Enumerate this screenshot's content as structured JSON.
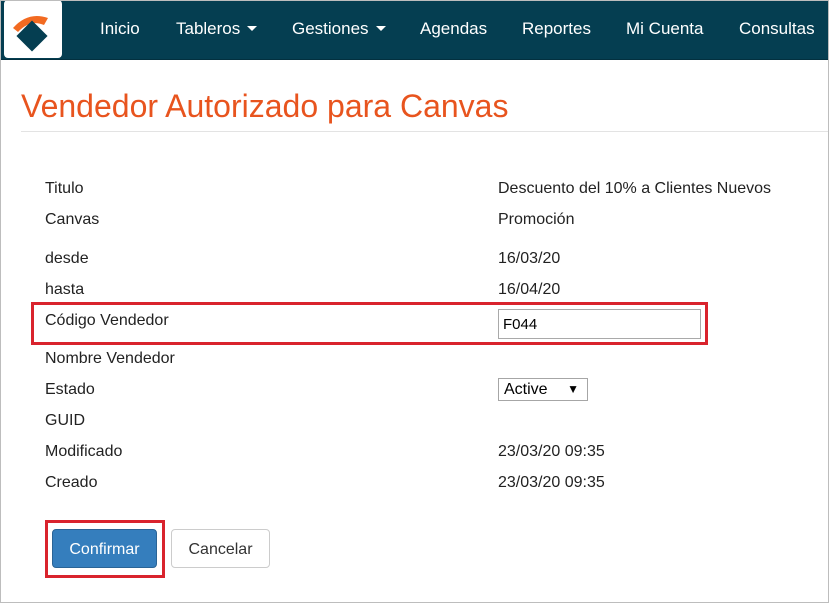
{
  "nav": {
    "items": [
      {
        "label": "Inicio",
        "has_caret": false
      },
      {
        "label": "Tableros",
        "has_caret": true
      },
      {
        "label": "Gestiones",
        "has_caret": true
      },
      {
        "label": "Agendas",
        "has_caret": false
      },
      {
        "label": "Reportes",
        "has_caret": false
      },
      {
        "label": "Mi Cuenta",
        "has_caret": false
      },
      {
        "label": "Consultas",
        "has_caret": false
      }
    ],
    "logo_icon": "company-logo-icon"
  },
  "page": {
    "title": "Vendedor Autorizado para Canvas"
  },
  "fields": {
    "titulo": {
      "label": "Titulo",
      "value": "Descuento del 10% a Clientes Nuevos"
    },
    "canvas": {
      "label": "Canvas",
      "value": "Promoción"
    },
    "desde": {
      "label": "desde",
      "value": "16/03/20"
    },
    "hasta": {
      "label": "hasta",
      "value": "16/04/20"
    },
    "codigo_vendedor": {
      "label": "Código Vendedor",
      "value": "F044"
    },
    "nombre_vendedor": {
      "label": "Nombre Vendedor",
      "value": ""
    },
    "estado": {
      "label": "Estado",
      "value": "Active"
    },
    "guid": {
      "label": "GUID",
      "value": ""
    },
    "modificado": {
      "label": "Modificado",
      "value": "23/03/20 09:35"
    },
    "creado": {
      "label": "Creado",
      "value": "23/03/20 09:35"
    }
  },
  "actions": {
    "confirm_label": "Confirmar",
    "cancel_label": "Cancelar"
  },
  "colors": {
    "navbar_bg": "#053e51",
    "title_orange": "#e8541e",
    "primary_button": "#357ebd",
    "highlight_red": "#d9232d"
  }
}
